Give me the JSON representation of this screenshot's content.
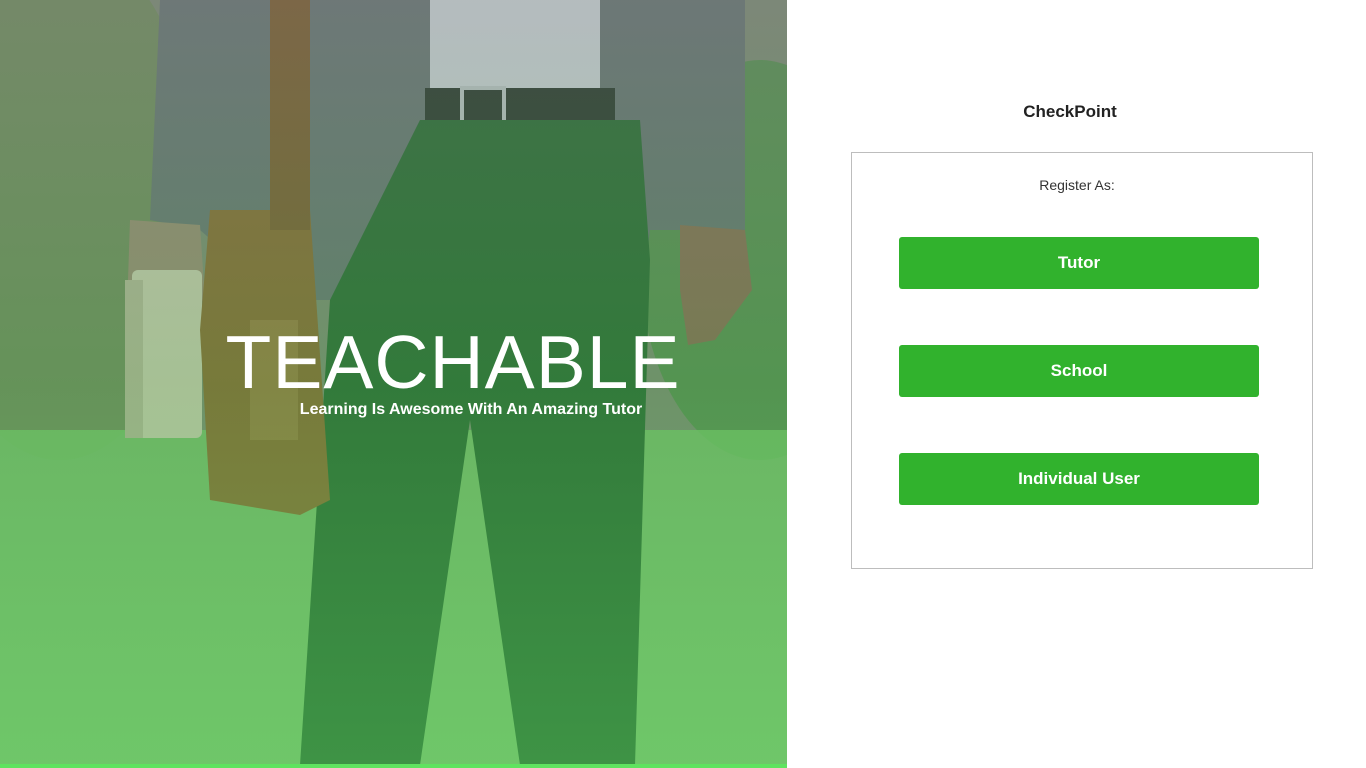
{
  "hero": {
    "title": "TEACHABLE",
    "subtitle": "Learning Is Awesome With An Amazing Tutor"
  },
  "brand": {
    "name": "CheckPoint"
  },
  "register": {
    "label": "Register As:",
    "options": [
      "Tutor",
      "School",
      "Individual User"
    ]
  },
  "colors": {
    "accent": "#31b22d",
    "overlay_green": "#5fd466",
    "card_border": "#bdbdbd",
    "text_dark": "#222222"
  }
}
